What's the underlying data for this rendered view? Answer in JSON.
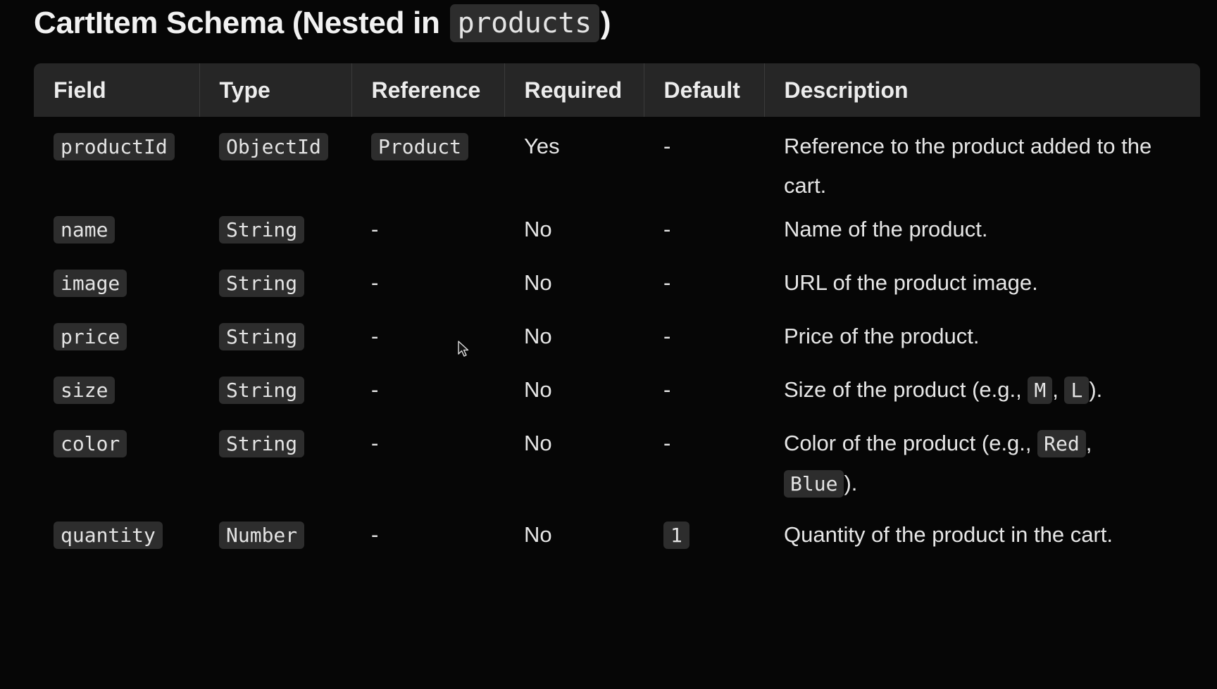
{
  "title": {
    "prefix": "CartItem Schema (Nested in",
    "code": "products",
    "suffix": ")"
  },
  "table": {
    "headers": [
      "Field",
      "Type",
      "Reference",
      "Required",
      "Default",
      "Description"
    ],
    "rows": [
      {
        "field": "productId",
        "type": "ObjectId",
        "reference": "Product",
        "required": "Yes",
        "default": "-",
        "description": "Reference to the product added to the cart."
      },
      {
        "field": "name",
        "type": "String",
        "reference": "-",
        "required": "No",
        "default": "-",
        "description": "Name of the product."
      },
      {
        "field": "image",
        "type": "String",
        "reference": "-",
        "required": "No",
        "default": "-",
        "description": "URL of the product image."
      },
      {
        "field": "price",
        "type": "String",
        "reference": "-",
        "required": "No",
        "default": "-",
        "description": "Price of the product."
      },
      {
        "field": "size",
        "type": "String",
        "reference": "-",
        "required": "No",
        "default": "-",
        "description_parts": {
          "pre": "Size of the product (e.g., ",
          "code1": "M",
          "mid": ", ",
          "code2": "L",
          "post": ")."
        }
      },
      {
        "field": "color",
        "type": "String",
        "reference": "-",
        "required": "No",
        "default": "-",
        "description_parts": {
          "pre": "Color of the product (e.g., ",
          "code1": "Red",
          "mid": ", ",
          "code2": "Blue",
          "post": ")."
        }
      },
      {
        "field": "quantity",
        "type": "Number",
        "reference": "-",
        "required": "No",
        "default": "1",
        "description": "Quantity of the product in the cart."
      }
    ]
  },
  "icons": {
    "cursor": "mouse-pointer-icon"
  }
}
